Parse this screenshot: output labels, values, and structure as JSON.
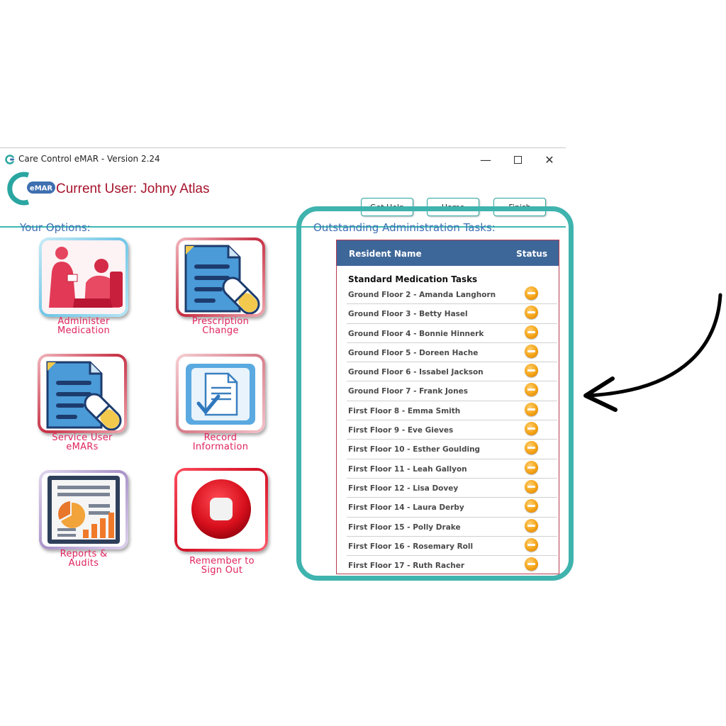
{
  "window": {
    "title": "Care Control eMAR - Version 2.24",
    "minimize_symbol": "—",
    "close_symbol": "✕"
  },
  "header": {
    "logo_text": "eMAR",
    "current_user": "Current User: Johny Atlas",
    "buttons": {
      "help": "Get Help",
      "home": "Home",
      "finish": "Finish"
    }
  },
  "options": {
    "heading": "Your Options:",
    "tiles": [
      {
        "line1": "Administer",
        "line2": "Medication",
        "icon": "nurse-patient-icon"
      },
      {
        "line1": "Prescription",
        "line2": "Change",
        "icon": "prescription-pill-icon"
      },
      {
        "line1": "Service User",
        "line2": "eMARs",
        "icon": "document-pill-icon"
      },
      {
        "line1": "Record",
        "line2": "Information",
        "icon": "document-check-icon"
      },
      {
        "line1": "Reports &",
        "line2": "Audits",
        "icon": "report-chart-icon"
      },
      {
        "line1": "Remember to",
        "line2": "Sign Out",
        "icon": "stop-icon"
      }
    ]
  },
  "tasks": {
    "heading": "Outstanding Administration Tasks:",
    "columns": {
      "name": "Resident Name",
      "status": "Status"
    },
    "group": "Standard Medication Tasks",
    "rows": [
      "Ground Floor 2 - Amanda Langhorn",
      "Ground Floor 3 - Betty Hasel",
      "Ground Floor 4 - Bonnie Hinnerk",
      "Ground Floor 5 - Doreen Hache",
      "Ground Floor 6 - Issabel Jackson",
      "Ground Floor 7 - Frank Jones",
      "First Floor 8 - Emma Smith",
      "First Floor 9 - Eve Gieves",
      "First Floor 10 - Esther Goulding",
      "First Floor 11 - Leah Gallyon",
      "First Floor 12 - Lisa Dovey",
      "First Floor 14 - Laura Derby",
      "First Floor 15 - Polly Drake",
      "First Floor 16 - Rosemary Roll",
      "First Floor 17 - Ruth Racher"
    ],
    "status_icon": "pending-minus-icon",
    "status_color": "#f4a316"
  },
  "annotation": {
    "highlight_color": "#3fb3ae",
    "arrow_color": "#000000"
  }
}
